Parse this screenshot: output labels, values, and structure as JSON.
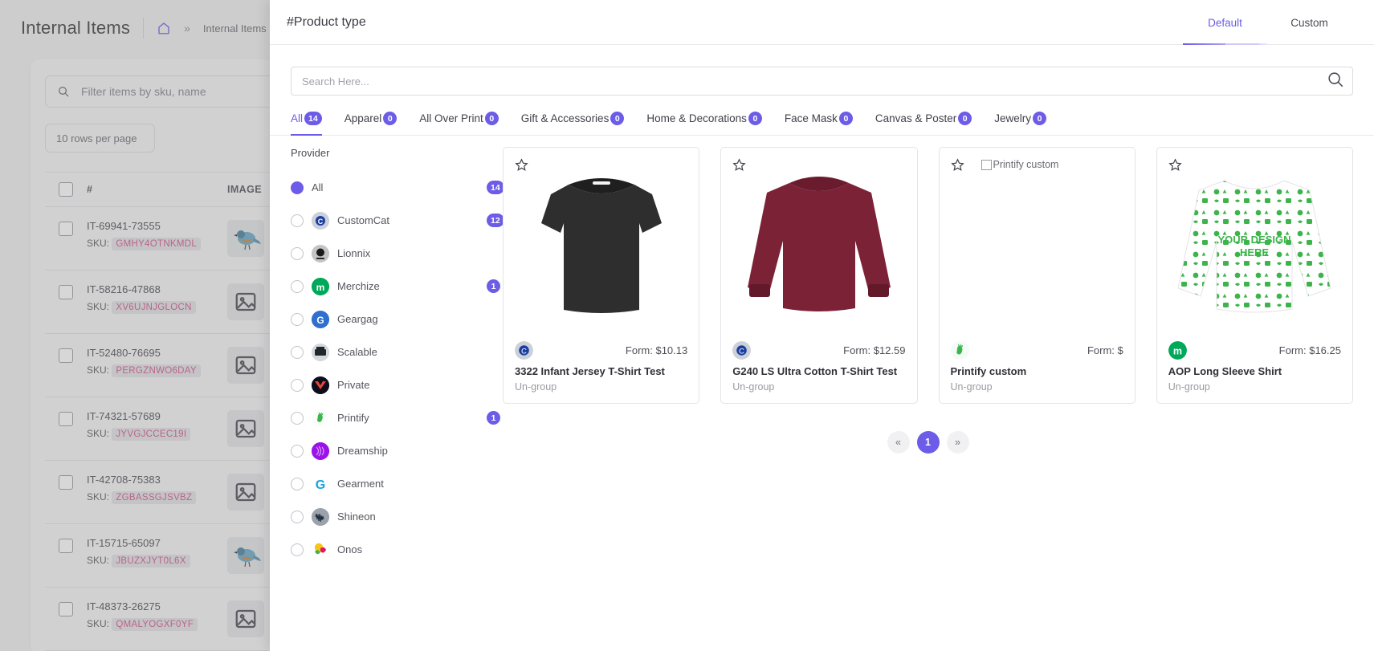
{
  "background": {
    "title": "Internal Items",
    "breadcrumb_arrow": "»",
    "breadcrumb": "Internal Items",
    "home_icon": "home-icon",
    "search_placeholder": "Filter items by sku, name",
    "rows_per_page": "10 rows per page",
    "columns": [
      "#",
      "IMAGE"
    ],
    "rows": [
      {
        "id": "IT-69941-73555",
        "sku_label": "SKU:",
        "sku": "GMHY4OTNKMDL",
        "thumb": "bird-photo"
      },
      {
        "id": "IT-58216-47868",
        "sku_label": "SKU:",
        "sku": "XV6UJNJGLOCN",
        "thumb": "image-placeholder-icon"
      },
      {
        "id": "IT-52480-76695",
        "sku_label": "SKU:",
        "sku": "PERGZNWO6DAY",
        "thumb": "image-placeholder-icon"
      },
      {
        "id": "IT-74321-57689",
        "sku_label": "SKU:",
        "sku": "JYVGJCCEC19I",
        "thumb": "image-placeholder-icon"
      },
      {
        "id": "IT-42708-75383",
        "sku_label": "SKU:",
        "sku": "ZGBASSGJSVBZ",
        "thumb": "image-placeholder-icon"
      },
      {
        "id": "IT-15715-65097",
        "sku_label": "SKU:",
        "sku": "JBUZXJYT0L6X",
        "thumb": "bird-photo"
      },
      {
        "id": "IT-48373-26275",
        "sku_label": "SKU:",
        "sku": "QMALYOGXF0YF",
        "thumb": "image-placeholder-icon"
      }
    ]
  },
  "drawer": {
    "title": "#Product type",
    "tabs": [
      {
        "label": "Default",
        "active": true
      },
      {
        "label": "Custom",
        "active": false
      }
    ],
    "search": {
      "placeholder": "Search Here...",
      "value": "",
      "icon": "search-icon"
    },
    "category_tabs": [
      {
        "label": "All",
        "count": "14",
        "active": true
      },
      {
        "label": "Apparel",
        "count": "0",
        "active": false
      },
      {
        "label": "All Over Print",
        "count": "0",
        "active": false
      },
      {
        "label": "Gift & Accessories",
        "count": "0",
        "active": false
      },
      {
        "label": "Home & Decorations",
        "count": "0",
        "active": false
      },
      {
        "label": "Face Mask",
        "count": "0",
        "active": false
      },
      {
        "label": "Canvas & Poster",
        "count": "0",
        "active": false
      },
      {
        "label": "Jewelry",
        "count": "0",
        "active": false
      }
    ],
    "provider": {
      "title": "Provider",
      "items": [
        {
          "label": "All",
          "count": "14",
          "selected": true,
          "logo": "none"
        },
        {
          "label": "CustomCat",
          "count": "12",
          "selected": false,
          "logo": "customcat-logo"
        },
        {
          "label": "Lionnix",
          "count": "",
          "selected": false,
          "logo": "lionnix-logo"
        },
        {
          "label": "Merchize",
          "count": "1",
          "selected": false,
          "logo": "merchize-logo"
        },
        {
          "label": "Geargag",
          "count": "",
          "selected": false,
          "logo": "geargag-logo"
        },
        {
          "label": "Scalable",
          "count": "",
          "selected": false,
          "logo": "scalable-logo"
        },
        {
          "label": "Private",
          "count": "",
          "selected": false,
          "logo": "private-logo"
        },
        {
          "label": "Printify",
          "count": "1",
          "selected": false,
          "logo": "printify-logo"
        },
        {
          "label": "Dreamship",
          "count": "",
          "selected": false,
          "logo": "dreamship-logo"
        },
        {
          "label": "Gearment",
          "count": "",
          "selected": false,
          "logo": "gearment-logo"
        },
        {
          "label": "Shineon",
          "count": "",
          "selected": false,
          "logo": "shineon-logo"
        },
        {
          "label": "Onos",
          "count": "",
          "selected": false,
          "logo": "onos-logo"
        }
      ]
    },
    "products": [
      {
        "name": "3322 Infant Jersey T-Shirt Test",
        "group": "Un-group",
        "price": "Form: $10.13",
        "provider_logo": "customcat-logo",
        "image": "black-infant-tshirt",
        "broken_image": false,
        "favorite": false
      },
      {
        "name": "G240 LS Ultra Cotton T-Shirt Test",
        "group": "Un-group",
        "price": "Form: $12.59",
        "provider_logo": "customcat-logo",
        "image": "maroon-long-sleeve-shirt",
        "broken_image": false,
        "favorite": false
      },
      {
        "name": "Printify custom",
        "group": "Un-group",
        "price": "Form: $",
        "provider_logo": "printify-logo",
        "image": "",
        "broken_image": true,
        "broken_alt": "Printify custom",
        "favorite": false
      },
      {
        "name": "AOP Long Sleeve Shirt",
        "group": "Un-group",
        "price": "Form: $16.25",
        "provider_logo": "merchize-logo",
        "image": "aop-long-sleeve-shirt",
        "broken_image": false,
        "favorite": false
      }
    ],
    "pagination": {
      "prev": "«",
      "next": "»",
      "pages": [
        "1"
      ],
      "current": "1"
    }
  },
  "colors": {
    "accent": "#6c5ce7",
    "badge": "#6c5ce7",
    "sku_text": "#d4568a",
    "text": "#3c3c44",
    "muted": "#9a9aa2"
  }
}
